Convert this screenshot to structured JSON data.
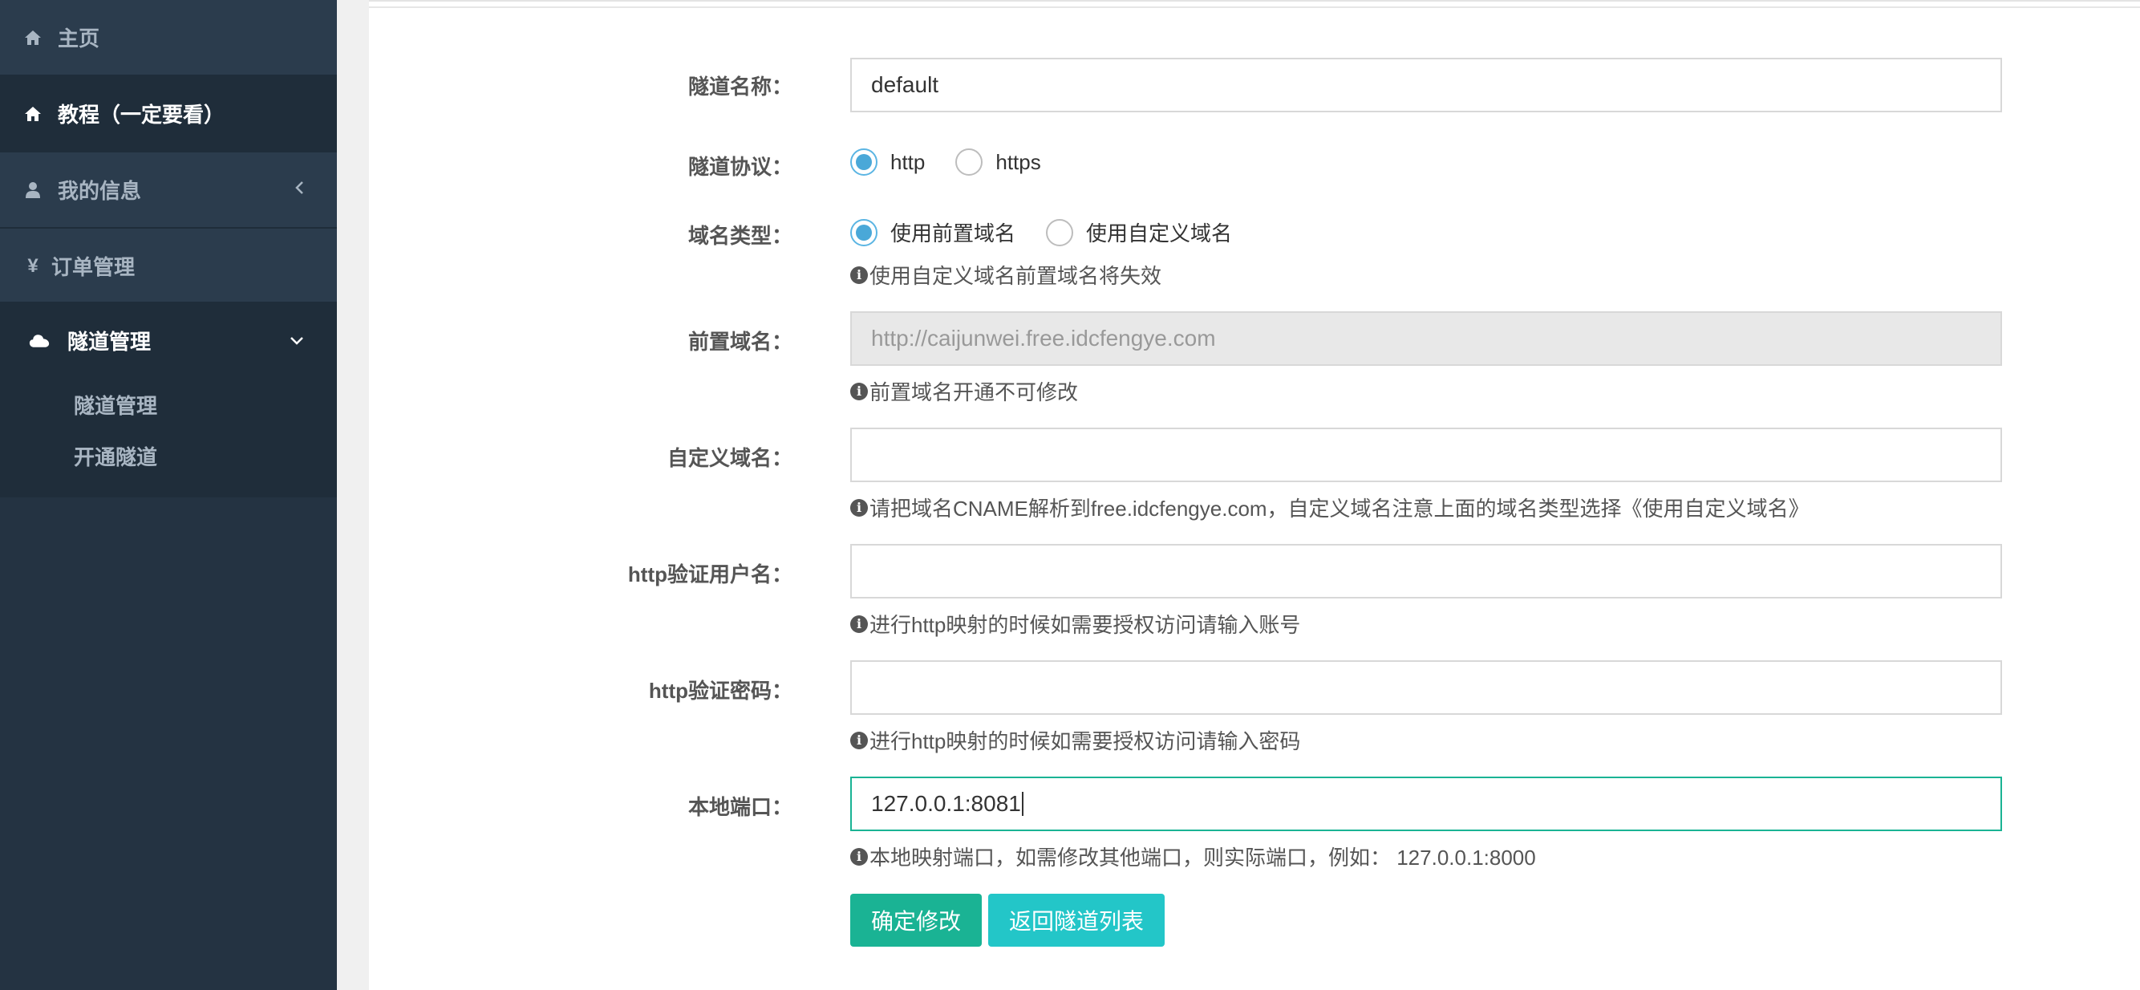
{
  "sidebar": {
    "items": [
      {
        "label": "主页",
        "icon": "home-icon"
      },
      {
        "label": "教程（一定要看）",
        "icon": "home-icon"
      },
      {
        "label": "我的信息",
        "icon": "user-icon"
      },
      {
        "label": "订单管理",
        "icon": "yen-icon"
      },
      {
        "label": "隧道管理",
        "icon": "cloud-icon"
      }
    ],
    "sub_items": [
      {
        "label": "隧道管理"
      },
      {
        "label": "开通隧道"
      }
    ]
  },
  "form": {
    "tunnel_name": {
      "label": "隧道名称：",
      "value": "default"
    },
    "protocol": {
      "label": "隧道协议：",
      "options": [
        "http",
        "https"
      ],
      "selected": "http"
    },
    "domain_type": {
      "label": "域名类型：",
      "options": [
        "使用前置域名",
        "使用自定义域名"
      ],
      "selected": "使用前置域名",
      "help": "使用自定义域名前置域名将失效"
    },
    "prefix_domain": {
      "label": "前置域名：",
      "value": "http://caijunwei.free.idcfengye.com",
      "help": "前置域名开通不可修改"
    },
    "custom_domain": {
      "label": "自定义域名：",
      "value": "",
      "help": "请把域名CNAME解析到free.idcfengye.com，自定义域名注意上面的域名类型选择《使用自定义域名》"
    },
    "http_user": {
      "label": "http验证用户名：",
      "value": "",
      "help": "进行http映射的时候如需要授权访问请输入账号"
    },
    "http_password": {
      "label": "http验证密码：",
      "value": "",
      "help": "进行http映射的时候如需要授权访问请输入密码"
    },
    "local_port": {
      "label": "本地端口：",
      "value": "127.0.0.1:8081",
      "help": "本地映射端口，如需修改其他端口，则实际端口，例如： 127.0.0.1:8000"
    },
    "submit_label": "确定修改",
    "back_label": "返回隧道列表"
  },
  "colors": {
    "sidebar_bg": "#2b3c4d",
    "primary": "#1ab394",
    "info": "#23c6c8",
    "radio": "#4aa8d8"
  }
}
